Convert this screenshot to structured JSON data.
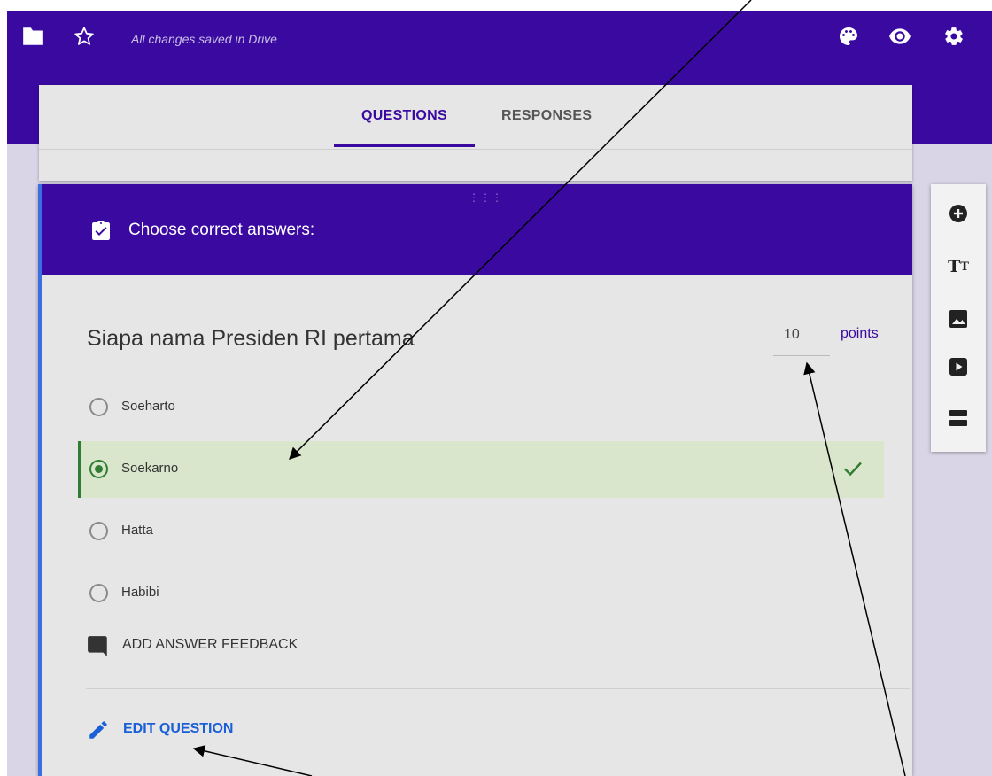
{
  "topbar": {
    "saved_status": "All changes saved in Drive",
    "icons": [
      "folder-icon",
      "star-icon",
      "palette-icon",
      "eye-icon",
      "gear-icon"
    ]
  },
  "tabs": [
    {
      "label": "QUESTIONS",
      "active": true
    },
    {
      "label": "RESPONSES",
      "active": false
    }
  ],
  "question_card": {
    "header_title": "Choose correct answers:",
    "drag_handle": "⋮⋮⋮",
    "question": "Siapa nama Presiden RI pertama",
    "points_value": "10",
    "points_label": "points",
    "options": [
      {
        "label": "Soeharto",
        "correct": false
      },
      {
        "label": "Soekarno",
        "correct": true
      },
      {
        "label": "Hatta",
        "correct": false
      },
      {
        "label": "Habibi",
        "correct": false
      }
    ],
    "add_feedback_label": "ADD ANSWER FEEDBACK",
    "edit_question_label": "EDIT QUESTION"
  },
  "sidebar": {
    "items": [
      "add-question-icon",
      "add-title-icon",
      "add-image-icon",
      "add-video-icon",
      "add-section-icon"
    ],
    "text_icon_glyph_big": "T",
    "text_icon_glyph_small": "T"
  },
  "colors": {
    "brand": "#3a0aa0",
    "background": "#d9d4e6",
    "card": "#e6e6e6",
    "correct_bg": "#d9e6cc",
    "correct": "#2e7d32",
    "link": "#1a5fd6"
  }
}
